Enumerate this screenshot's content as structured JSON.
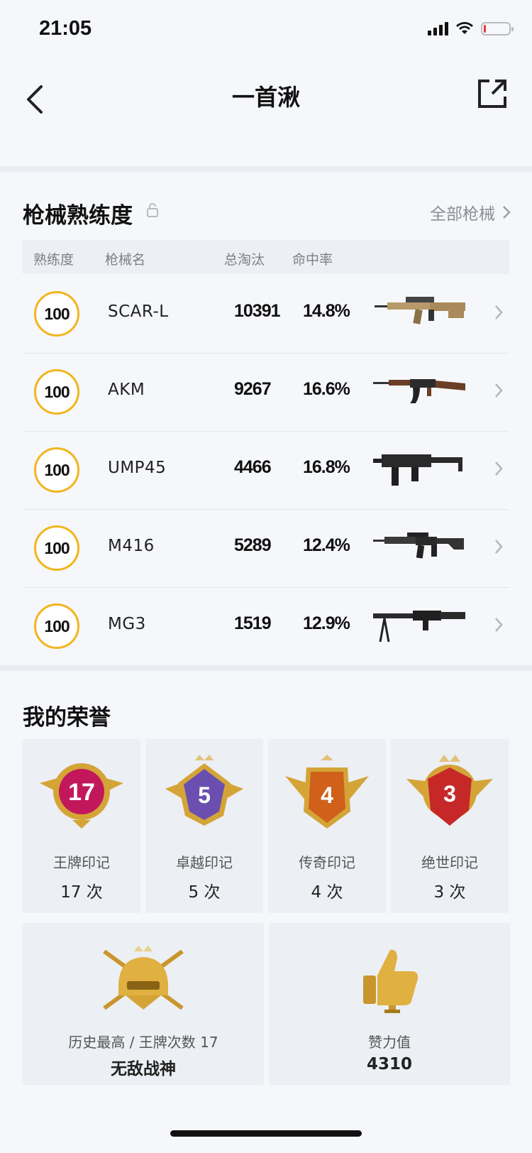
{
  "status_bar": {
    "time": "21:05"
  },
  "nav": {
    "title": "一首湫"
  },
  "weapons": {
    "title": "枪械熟练度",
    "all_link": "全部枪械",
    "headers": {
      "proficiency": "熟练度",
      "name": "枪械名",
      "kills": "总淘汰",
      "accuracy": "命中率"
    },
    "rows": [
      {
        "proficiency": "100",
        "name": "SCAR-L",
        "kills": "10391",
        "accuracy": "14.8%",
        "gun_icon": "scar-l-icon"
      },
      {
        "proficiency": "100",
        "name": "AKM",
        "kills": "9267",
        "accuracy": "16.6%",
        "gun_icon": "akm-icon"
      },
      {
        "proficiency": "100",
        "name": "UMP45",
        "kills": "4466",
        "accuracy": "16.8%",
        "gun_icon": "ump45-icon"
      },
      {
        "proficiency": "100",
        "name": "M416",
        "kills": "5289",
        "accuracy": "12.4%",
        "gun_icon": "m416-icon"
      },
      {
        "proficiency": "100",
        "name": "MG3",
        "kills": "1519",
        "accuracy": "12.9%",
        "gun_icon": "mg3-icon"
      }
    ]
  },
  "honor": {
    "title": "我的荣誉",
    "medals": [
      {
        "number": "17",
        "name": "王牌印记",
        "count": "17 次",
        "color": "#c2185b"
      },
      {
        "number": "5",
        "name": "卓越印记",
        "count": "5 次",
        "color": "#6a4fb0"
      },
      {
        "number": "4",
        "name": "传奇印记",
        "count": "4 次",
        "color": "#d0601a"
      },
      {
        "number": "3",
        "name": "绝世印记",
        "count": "3 次",
        "color": "#c62828"
      }
    ],
    "highest": {
      "label": "历史最高 / 王牌次数 17",
      "value": "无敌战神"
    },
    "likes": {
      "label": "赞力值",
      "value": "4310"
    }
  },
  "colors": {
    "accent_ring": "#f2b51c",
    "gold": "#d4a437"
  }
}
